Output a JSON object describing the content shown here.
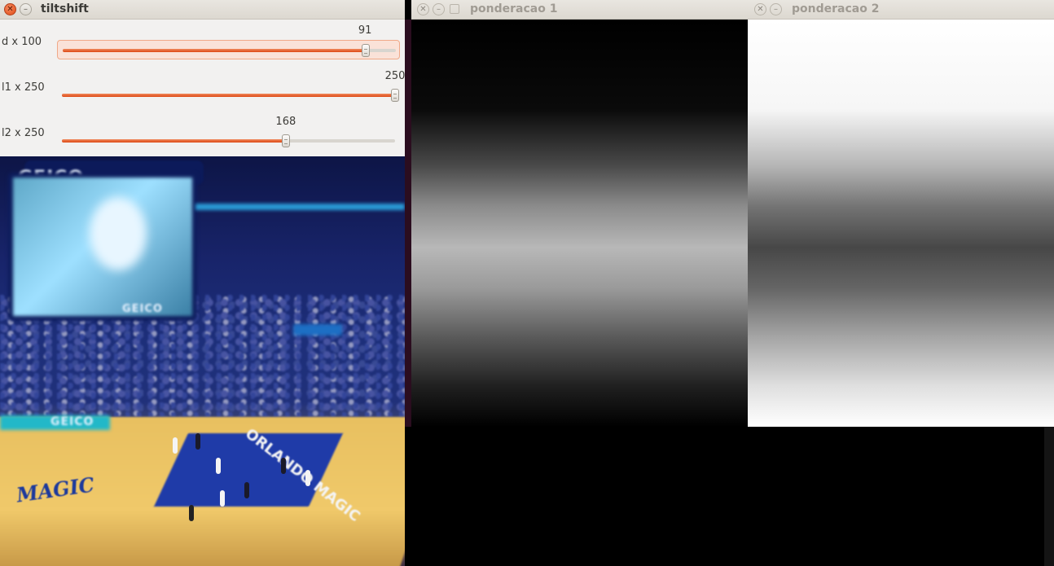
{
  "windows": {
    "tiltshift": {
      "title": "tiltshift",
      "trackbars": [
        {
          "label": "d x 100",
          "value": "91",
          "value_num": 91,
          "max": 100
        },
        {
          "label": "l1 x 250",
          "value": "250",
          "value_num": 250,
          "max": 250
        },
        {
          "label": "l2 x 250",
          "value": "168",
          "value_num": 168,
          "max": 250
        }
      ],
      "image": {
        "sign_geico_top": "GEICO",
        "sign_geico_left": "GEICO",
        "sign_geico_low": "GEICO",
        "court_logo": "MAGIC",
        "court_text": "ORLANDO MAGIC"
      }
    },
    "ponderacao1": {
      "title": "ponderacao 1"
    },
    "ponderacao2": {
      "title": "ponderacao 2"
    }
  },
  "colors": {
    "accent": "#dd4814",
    "titlebar": "#dcd8d0",
    "panel": "#f2f1f0"
  },
  "icons": [
    "close-icon",
    "minimize-icon",
    "maximize-icon"
  ]
}
